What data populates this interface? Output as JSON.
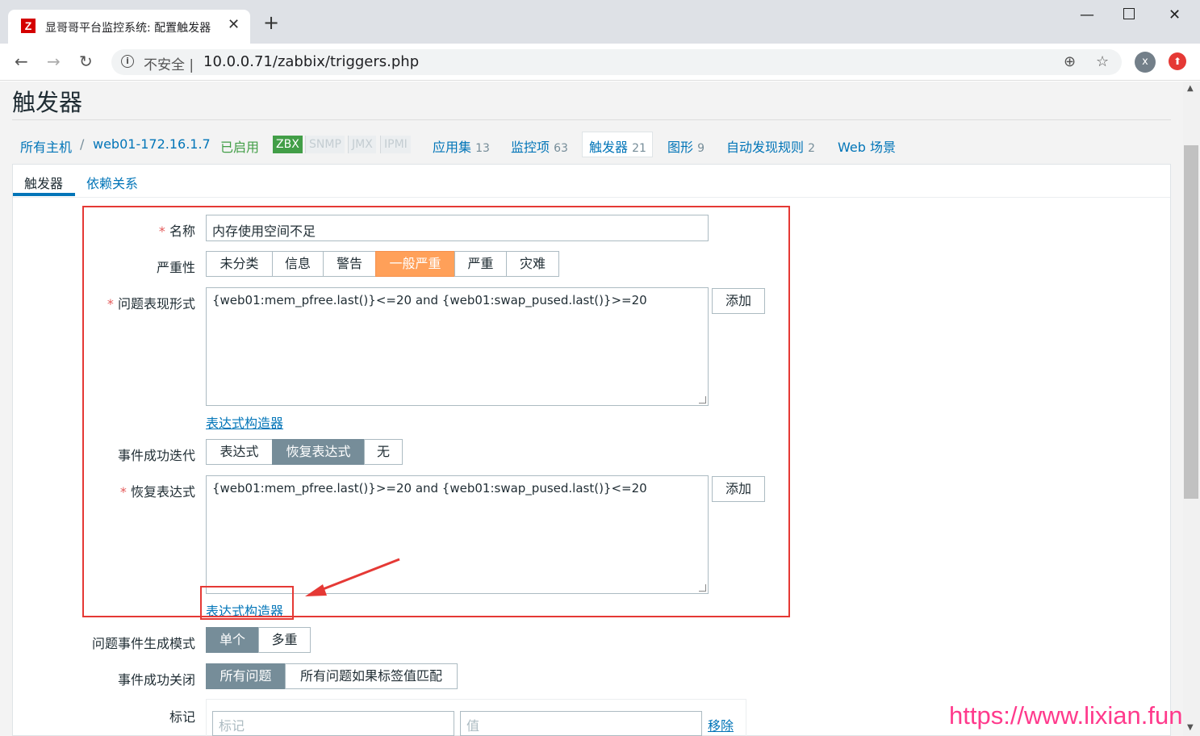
{
  "browser": {
    "tab_title": "显哥哥平台监控系统: 配置触发器",
    "favicon_letter": "Z",
    "new_tab_icon": "+",
    "security_label": "不安全",
    "url": "10.0.0.71/zabbix/triggers.php",
    "avatar_letter": "x"
  },
  "page": {
    "title": "触发器",
    "breadcrumb": {
      "all_hosts": "所有主机",
      "separator": "/",
      "host": "web01-172.16.1.7",
      "status": "已启用",
      "tags": [
        "ZBX",
        "SNMP",
        "JMX",
        "IPMI"
      ],
      "nav": [
        {
          "label": "应用集",
          "count": "13"
        },
        {
          "label": "监控项",
          "count": "63"
        },
        {
          "label": "触发器",
          "count": "21"
        },
        {
          "label": "图形",
          "count": "9"
        },
        {
          "label": "自动发现规则",
          "count": "2"
        },
        {
          "label": "Web 场景",
          "count": ""
        }
      ]
    },
    "tabs": [
      "触发器",
      "依赖关系"
    ]
  },
  "form": {
    "name_label": "名称",
    "name_value": "内存使用空间不足",
    "severity_label": "严重性",
    "severity_options": [
      "未分类",
      "信息",
      "警告",
      "一般严重",
      "严重",
      "灾难"
    ],
    "severity_selected": "一般严重",
    "problem_expr_label": "问题表现形式",
    "problem_expr_value": "{web01:mem_pfree.last()}<=20 and {web01:swap_pused.last()}>=20",
    "add_label": "添加",
    "expr_builder_label": "表达式构造器",
    "ok_event_label": "事件成功迭代",
    "ok_event_options": [
      "表达式",
      "恢复表达式",
      "无"
    ],
    "ok_event_selected": "恢复表达式",
    "recovery_expr_label": "恢复表达式",
    "recovery_expr_value": "{web01:mem_pfree.last()}>=20 and {web01:swap_pused.last()}<=20",
    "problem_mode_label": "问题事件生成模式",
    "problem_mode_options": [
      "单个",
      "多重"
    ],
    "problem_mode_selected": "单个",
    "ok_close_label": "事件成功关闭",
    "ok_close_options": [
      "所有问题",
      "所有问题如果标签值匹配"
    ],
    "ok_close_selected": "所有问题",
    "tags_label": "标记",
    "tag_placeholder": "标记",
    "value_placeholder": "值",
    "remove_label": "移除"
  },
  "watermark": "https://www.lixian.fun",
  "colors": {
    "link": "#0275b8",
    "severity_average": "#ffa059",
    "selected_grey": "#768d99",
    "annotation_red": "#e53935",
    "watermark": "#ff3a8c"
  }
}
